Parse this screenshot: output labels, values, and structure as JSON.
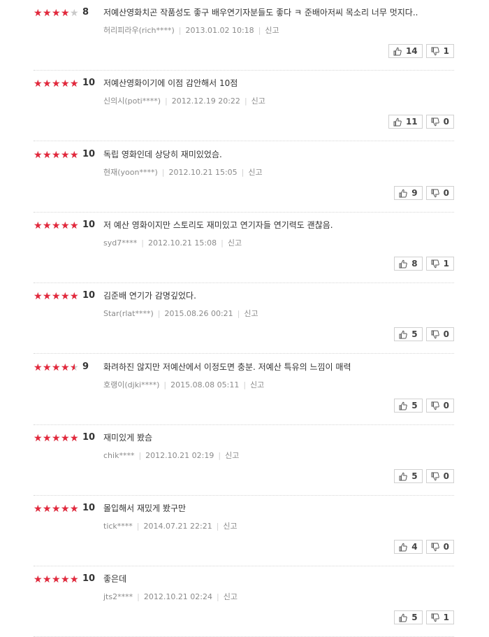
{
  "reviews": [
    {
      "rating": 8,
      "text": "저예산영화치곤 작품성도 좋구 배우연기자분들도 좋다 ㅋ 준배아저씨 목소리 너무 멋지다..",
      "author": "허리피라우(rich****)",
      "date": "2013.01.02 10:18",
      "report": "신고",
      "likes": "14",
      "dislikes": "1"
    },
    {
      "rating": 10,
      "text": "저예산영화이기에 이점 감안해서 10점",
      "author": "신의시(poti****)",
      "date": "2012.12.19 20:22",
      "report": "신고",
      "likes": "11",
      "dislikes": "0"
    },
    {
      "rating": 10,
      "text": "독립 영화인데 상당히 재미있었슴.",
      "author": "현재(yoon****)",
      "date": "2012.10.21 15:05",
      "report": "신고",
      "likes": "9",
      "dislikes": "0"
    },
    {
      "rating": 10,
      "text": "저 예산 영화이지만 스토리도 재미있고 연기자들 연기력도 괜찮음.",
      "author": "syd7****",
      "date": "2012.10.21 15:08",
      "report": "신고",
      "likes": "8",
      "dislikes": "1"
    },
    {
      "rating": 10,
      "text": "김준배 연기가 감명깊었다.",
      "author": "Star(rlat****)",
      "date": "2015.08.26 00:21",
      "report": "신고",
      "likes": "5",
      "dislikes": "0"
    },
    {
      "rating": 9,
      "text": "화려하진 않지만 저예산에서 이정도면 충분. 저예산 특유의 느낌이 매력",
      "author": "호랭이(djki****)",
      "date": "2015.08.08 05:11",
      "report": "신고",
      "likes": "5",
      "dislikes": "0"
    },
    {
      "rating": 10,
      "text": "재미있게 봤슴",
      "author": "chik****",
      "date": "2012.10.21 02:19",
      "report": "신고",
      "likes": "5",
      "dislikes": "0"
    },
    {
      "rating": 10,
      "text": "몰입해서 재밌게 봤구만",
      "author": "tick****",
      "date": "2014.07.21 22:21",
      "report": "신고",
      "likes": "4",
      "dislikes": "0"
    },
    {
      "rating": 10,
      "text": "좋은데",
      "author": "jts2****",
      "date": "2012.10.21 02:24",
      "report": "신고",
      "likes": "5",
      "dislikes": "1"
    }
  ],
  "colors": {
    "star_filled": "#e3283c",
    "star_empty": "#c9c9c9",
    "text": "#333333",
    "meta": "#8a8a8a"
  },
  "icons": {
    "like": "thumbs-up-icon",
    "dislike": "thumbs-down-icon",
    "rating": "star-icon"
  }
}
